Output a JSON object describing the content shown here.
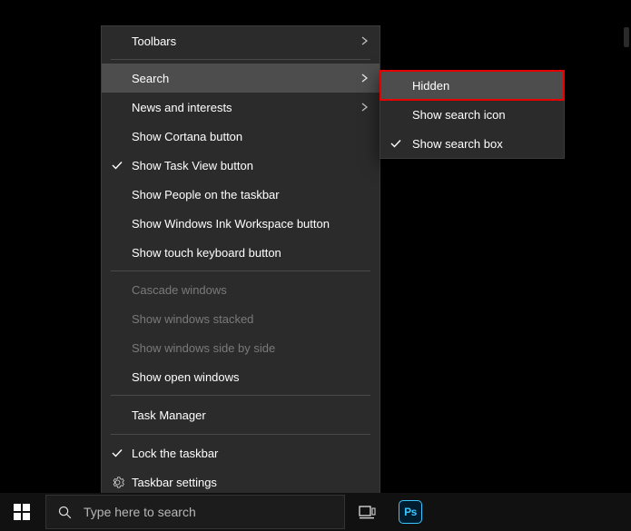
{
  "context_menu": {
    "toolbars": "Toolbars",
    "search": "Search",
    "news": "News and interests",
    "cortana": "Show Cortana button",
    "taskview": "Show Task View button",
    "people": "Show People on the taskbar",
    "ink": "Show Windows Ink Workspace button",
    "touchkb": "Show touch keyboard button",
    "cascade": "Cascade windows",
    "stacked": "Show windows stacked",
    "sidebyside": "Show windows side by side",
    "showopen": "Show open windows",
    "taskmgr": "Task Manager",
    "lock": "Lock the taskbar",
    "settings": "Taskbar settings"
  },
  "search_submenu": {
    "hidden": "Hidden",
    "icon": "Show search icon",
    "box": "Show search box"
  },
  "taskbar": {
    "search_placeholder": "Type here to search",
    "ps": "Ps"
  }
}
